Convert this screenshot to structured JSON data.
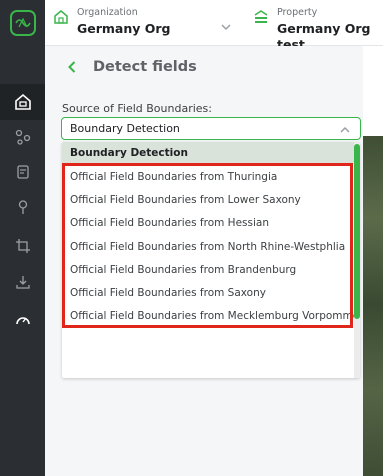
{
  "header": {
    "organization_label": "Organization",
    "organization_value": "Germany Org",
    "property_label": "Property",
    "property_value": "Germany Org test"
  },
  "panel": {
    "title": "Detect fields"
  },
  "source_field": {
    "label": "Source of Field Boundaries:",
    "selected_value": "Boundary Detection"
  },
  "dropdown": {
    "options": [
      "Boundary Detection",
      "Official Field Boundaries from Thuringia",
      "Official Field Boundaries from Lower Saxony",
      "Official Field Boundaries from Hessian",
      "Official Field Boundaries from North Rhine-Westphlia",
      "Official Field Boundaries from Brandenburg",
      "Official Field Boundaries from Saxony",
      "Official Field Boundaries from Mecklemburg Vorpommer"
    ],
    "selected_index": 0
  },
  "sidebar": {
    "items": [
      "property-icon",
      "share-nodes-icon",
      "notes-icon",
      "pin-icon",
      "crop-icon",
      "download-icon",
      "gauge-icon"
    ],
    "active_index": 0
  },
  "colors": {
    "accent": "#39b54a",
    "highlight": "#e0251b",
    "rail": "#2b2f33"
  }
}
